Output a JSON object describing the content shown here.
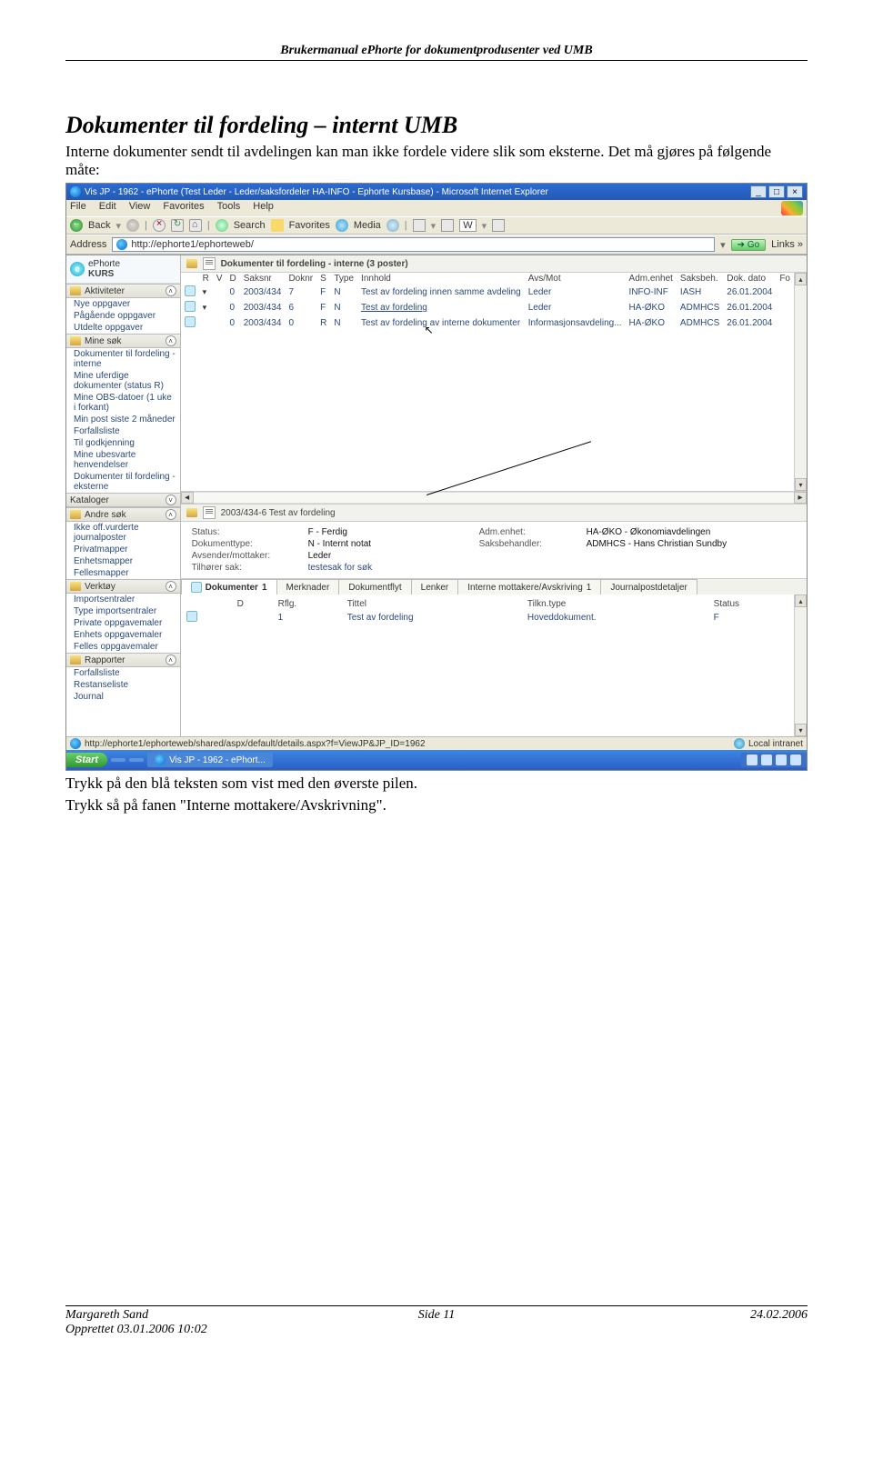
{
  "doc": {
    "header": "Brukermanual ePhorte for dokumentprodusenter ved UMB",
    "section_title": "Dokumenter til fordeling – internt UMB",
    "section_intro": "Interne dokumenter sendt til avdelingen kan man ikke fordele videre slik som eksterne. Det må gjøres på følgende måte:",
    "after1": "Trykk på den blå teksten som vist med den øverste pilen.",
    "after2": "Trykk så på fanen \"Interne mottakere/Avskrivning\".",
    "footer_author": "Margareth Sand",
    "footer_created": "Opprettet 03.01.2006 10:02",
    "footer_page": "Side 11",
    "footer_date": "24.02.2006"
  },
  "ie": {
    "title": "Vis JP - 1962 - ePhorte (Test Leder - Leder/saksfordeler HA-INFO - Ephorte Kursbase) - Microsoft Internet Explorer",
    "menus": [
      "File",
      "Edit",
      "View",
      "Favorites",
      "Tools",
      "Help"
    ],
    "back": "Back",
    "search": "Search",
    "favorites": "Favorites",
    "media": "Media",
    "w": "W",
    "address_label": "Address",
    "url": "http://ephorte1/ephorteweb/",
    "go": "Go",
    "links": "Links »",
    "status_url": "http://ephorte1/ephorteweb/shared/aspx/default/details.aspx?f=ViewJP&JP_ID=1962",
    "zone": "Local intranet"
  },
  "app": {
    "logo_top": "ePhorte",
    "logo_bottom": "KURS",
    "left_sections": [
      {
        "title": "Aktiviteter",
        "items": [
          "Nye oppgaver",
          "Pågående oppgaver",
          "Utdelte oppgaver"
        ]
      },
      {
        "title": "Mine søk",
        "items": [
          "Dokumenter til fordeling - interne",
          "Mine uferdige dokumenter (status R)",
          "Mine OBS-datoer (1 uke i forkant)",
          "Min post siste 2 måneder",
          "Forfallsliste",
          "Til godkjenning",
          "Mine ubesvarte henvendelser",
          "Dokumenter til fordeling - eksterne"
        ]
      },
      {
        "title": "Kataloger",
        "items": []
      },
      {
        "title": "Andre søk",
        "items": [
          "Ikke off.vurderte journalposter",
          "Privatmapper",
          "Enhetsmapper",
          "Fellesmapper"
        ]
      },
      {
        "title": "Verktøy",
        "items": [
          "Importsentraler",
          "Type importsentraler",
          "Private oppgavemaler",
          "Enhets oppgavemaler",
          "Felles oppgavemaler"
        ]
      },
      {
        "title": "Rapporter",
        "items": [
          "Forfallsliste",
          "Restanseliste",
          "Journal"
        ]
      }
    ],
    "list_title": "Dokumenter til fordeling - interne (3 poster)",
    "columns": [
      "R",
      "V",
      "D",
      "Saksnr",
      "Doknr",
      "S",
      "Type",
      "Innhold",
      "Avs/Mot",
      "Adm.enhet",
      "Saksbeh.",
      "Dok. dato",
      "Fo"
    ],
    "rows": [
      {
        "saksnr": "2003/434",
        "doknr": "7",
        "s": "F",
        "type": "N",
        "innhold": "Test av fordeling innen samme avdeling",
        "avs": "Leder",
        "adm": "INFO-INF",
        "saksbeh": "IASH",
        "dato": "26.01.2004"
      },
      {
        "saksnr": "2003/434",
        "doknr": "6",
        "s": "F",
        "type": "N",
        "innhold": "Test av fordeling",
        "avs": "Leder",
        "adm": "HA-ØKO",
        "saksbeh": "ADMHCS",
        "dato": "26.01.2004"
      },
      {
        "saksnr": "2003/434",
        "doknr": "0",
        "s": "R",
        "type": "N",
        "innhold": "Test av fordeling av interne dokumenter",
        "avs": "Informasjonsavdeling...",
        "adm": "HA-ØKO",
        "saksbeh": "ADMHCS",
        "dato": "26.01.2004"
      }
    ],
    "detail_title": "2003/434-6  Test av fordeling",
    "fields": {
      "status_lbl": "Status:",
      "status": "F - Ferdig",
      "type_lbl": "Dokumenttype:",
      "type": "N - Internt notat",
      "avs_lbl": "Avsender/mottaker:",
      "avs": "Leder",
      "sak_lbl": "Tilhører sak:",
      "sak": "testesak for søk",
      "adm_lbl": "Adm.enhet:",
      "adm": "HA-ØKO - Økonomiavdelingen",
      "beh_lbl": "Saksbehandler:",
      "beh": "ADMHCS - Hans Christian Sundby"
    },
    "tabs": [
      {
        "label": "Dokumenter",
        "count": "1"
      },
      {
        "label": "Merknader"
      },
      {
        "label": "Dokumentflyt"
      },
      {
        "label": "Lenker"
      },
      {
        "label": "Interne mottakere/Avskriving",
        "count": "1"
      },
      {
        "label": "Journalpostdetaljer"
      }
    ],
    "doc_columns": [
      "D",
      "Rflg.",
      "Tittel",
      "Tilkn.type",
      "Status"
    ],
    "doc_row": {
      "rflg": "1",
      "tittel": "Test av fordeling",
      "tilkn": "Hoveddokument.",
      "status": "F"
    }
  },
  "taskbar": {
    "start": "Start",
    "task": "Vis JP - 1962 - ePhort..."
  }
}
